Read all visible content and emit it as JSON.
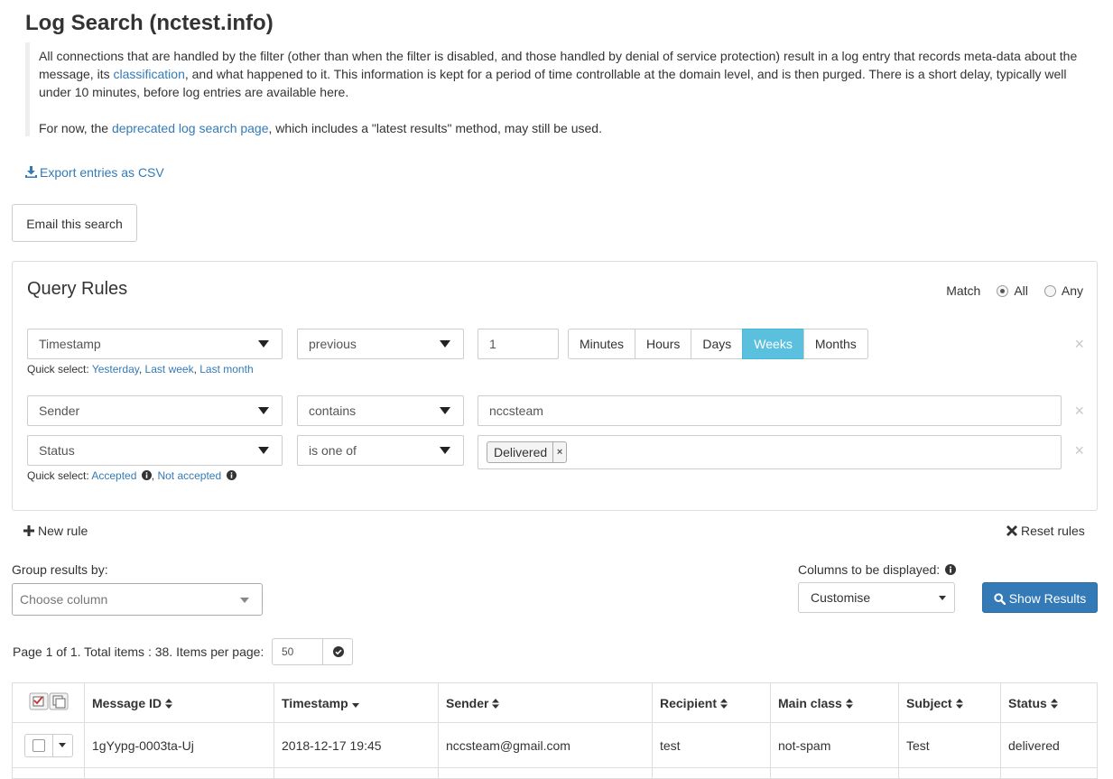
{
  "page": {
    "title": "Log Search (nctest.info)"
  },
  "intro": {
    "p1_before": "All connections that are handled by the filter (other than when the filter is disabled, and those handled by denial of service protection) result in a log entry that records meta-data about the message, its ",
    "p1_link": "classification",
    "p1_after": ", and what happened to it. This information is kept for a period of time controllable at the domain level, and is then purged. There is a short delay, typically well under 10 minutes, before log entries are available here.",
    "p2_before": "For now, the ",
    "p2_link": "deprecated log search page",
    "p2_after": ", which includes a \"latest results\" method, may still be used."
  },
  "export_label": "Export entries as CSV",
  "email_search_label": "Email this search",
  "query": {
    "title": "Query Rules",
    "match_label": "Match",
    "match_all": "All",
    "match_any": "Any",
    "match_selected": "All",
    "rules": [
      {
        "field": "Timestamp",
        "operator": "previous",
        "value": "1",
        "units": [
          "Minutes",
          "Hours",
          "Days",
          "Weeks",
          "Months"
        ],
        "active_unit": "Weeks",
        "quick_label": "Quick select:",
        "quick": [
          "Yesterday",
          "Last week",
          "Last month"
        ]
      },
      {
        "field": "Sender",
        "operator": "contains",
        "value": "nccsteam"
      },
      {
        "field": "Status",
        "operator": "is one of",
        "tag": "Delivered",
        "tag_remove": "×",
        "quick_label": "Quick select:",
        "quick": [
          "Accepted",
          "Not accepted"
        ]
      }
    ],
    "remove_glyph": "×"
  },
  "new_rule_label": "New rule",
  "reset_rules_label": "Reset rules",
  "group": {
    "label": "Group results by:",
    "placeholder": "Choose column"
  },
  "columns": {
    "label": "Columns to be displayed:",
    "value": "Customise"
  },
  "show_results_label": "Show Results",
  "pagination": {
    "text": "Page 1 of 1. Total items : 38. Items per page:",
    "per_page": "50"
  },
  "table": {
    "headers": [
      "Message ID",
      "Timestamp",
      "Sender",
      "Recipient",
      "Main class",
      "Subject",
      "Status"
    ],
    "sorted_column": "Timestamp",
    "rows": [
      [
        "1gYypg-0003ta-Uj",
        "2018-12-17 19:45",
        "nccsteam@gmail.com",
        "test",
        "not-spam",
        "Test",
        "delivered"
      ]
    ]
  },
  "colors": {
    "link": "#337ab7",
    "active_unit": "#5bc0de",
    "primary": "#337ab7"
  }
}
